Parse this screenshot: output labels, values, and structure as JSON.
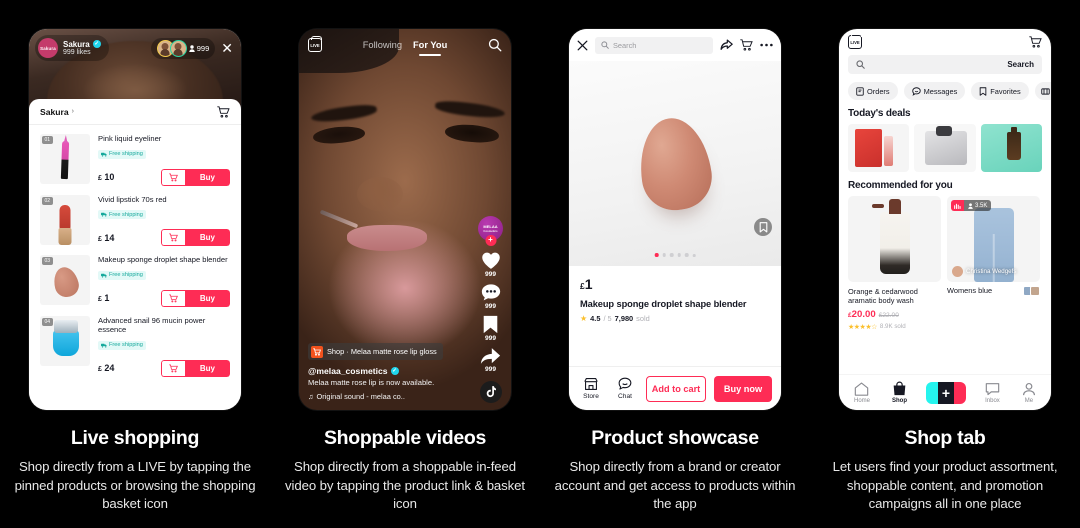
{
  "panels": [
    {
      "caption_title": "Live shopping",
      "caption_body": "Shop directly from a LIVE by tapping the pinned products or browsing the shopping basket icon"
    },
    {
      "caption_title": "Shoppable videos",
      "caption_body": "Shop directly from a shoppable in-feed video by tapping the product link & basket icon"
    },
    {
      "caption_title": "Product showcase",
      "caption_body": "Shop directly from a brand or creator account and get access to products within the app"
    },
    {
      "caption_title": "Shop tab",
      "caption_body": "Let users find your product assortment, shoppable content, and promotion campaigns all in one place"
    }
  ],
  "live": {
    "host_name": "Sakura",
    "host_avatar_text": "Sakura",
    "likes": "999 likes",
    "viewer_count": "999",
    "close_icon": "close-icon",
    "shop_name": "Sakura",
    "chevron": "›",
    "cart_icon": "shopping-cart-icon",
    "buy_label": "Buy",
    "free_shipping": "Free shipping",
    "products": [
      {
        "rank": "01",
        "name": "Pink liquid eyeliner",
        "currency": "£",
        "price": "10"
      },
      {
        "rank": "02",
        "name": "Vivid lipstick 70s red",
        "currency": "£",
        "price": "14"
      },
      {
        "rank": "03",
        "name": "Makeup sponge droplet shape blender",
        "currency": "£",
        "price": "1"
      },
      {
        "rank": "04",
        "name": "Advanced snail 96 mucin power essence",
        "currency": "£",
        "price": "24"
      }
    ]
  },
  "video": {
    "live_badge": "LIVE",
    "tab_following": "Following",
    "tab_foryou": "For You",
    "search_icon": "search-icon",
    "profile_name": "MELAA",
    "profile_sub": "Cosmetics",
    "follow_plus": "+",
    "like_count": "999",
    "comment_count": "999",
    "bookmark_count": "999",
    "share_count": "999",
    "shop_label": "Shop",
    "shop_product": "Melaa matte rose lip gloss",
    "shop_separator": "·",
    "handle": "@melaa_cosmetics",
    "description": "Melaa matte rose lip is now available.",
    "music_note": "♫",
    "music": "Original sound - melaa co.."
  },
  "product": {
    "close_icon": "close-icon",
    "search_placeholder": "Search",
    "share_icon": "share-icon",
    "cart_icon": "shopping-cart-icon",
    "more_icon": "more-options-icon",
    "bookmark_icon": "bookmark-icon",
    "currency": "£",
    "price": "1",
    "title": "Makeup sponge droplet shape blender",
    "rating": "4.5",
    "rating_max": "/ 5",
    "sold_count": "7,980",
    "sold_label": "sold",
    "store_label": "Store",
    "chat_label": "Chat",
    "add_to_cart": "Add to cart",
    "buy_now": "Buy now",
    "dots_total": 6,
    "dots_active": 0
  },
  "shop": {
    "live_badge": "LIVE",
    "cart_icon": "shopping-cart-icon",
    "search_label": "Search",
    "chips": [
      {
        "label": "Orders",
        "icon": "orders-icon"
      },
      {
        "label": "Messages",
        "icon": "messages-icon"
      },
      {
        "label": "Favorites",
        "icon": "bookmark-icon"
      },
      {
        "label": "",
        "icon": "coupon-icon"
      }
    ],
    "deals_heading": "Today's deals",
    "recommended_heading": "Recommended for you",
    "cards": [
      {
        "name": "Orange & cedarwood aramatic body wash",
        "currency": "£",
        "price": "20.00",
        "old_price": "£22.00",
        "stars": "★★★★☆",
        "sold": "8.9K sold"
      },
      {
        "name": "Womens blue",
        "live_viewers": "3.5K",
        "creator": "Christina Wedgefs"
      }
    ],
    "nav": [
      {
        "label": "Home",
        "icon": "home-icon",
        "active": false
      },
      {
        "label": "Shop",
        "icon": "shop-bag-icon",
        "active": true
      },
      {
        "label": "+",
        "icon": "create-icon",
        "active": false
      },
      {
        "label": "Inbox",
        "icon": "inbox-icon",
        "active": false
      },
      {
        "label": "Me",
        "icon": "profile-icon",
        "active": false
      }
    ]
  },
  "colors": {
    "accent": "#fe2c55",
    "verified": "#20d5ec",
    "shipping": "#17a99c",
    "background": "#000000"
  }
}
